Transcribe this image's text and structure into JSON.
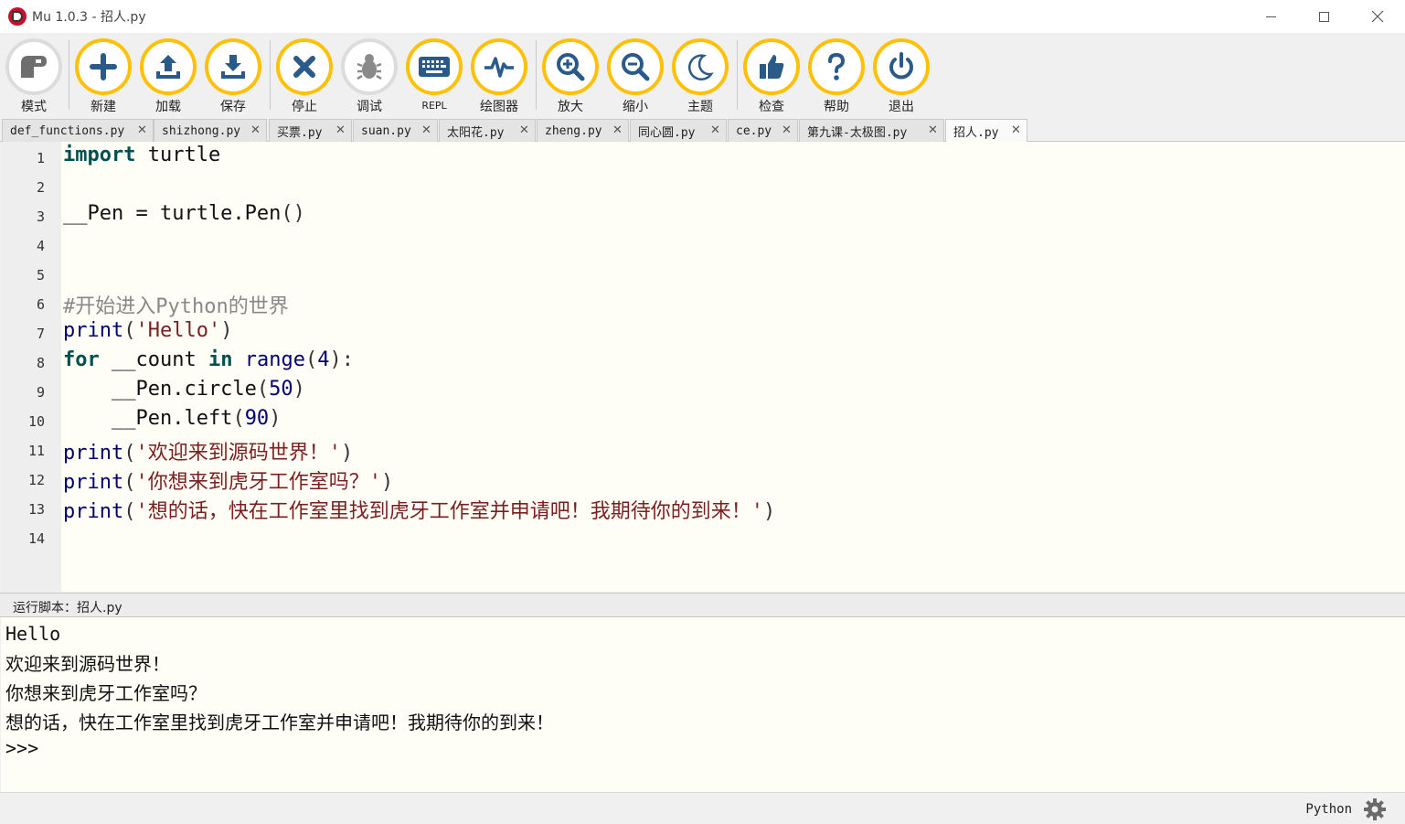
{
  "window": {
    "title": "Mu 1.0.3 - 招人.py"
  },
  "toolbar": {
    "buttons": [
      {
        "label": "模式",
        "icon": "mode-icon"
      },
      {
        "label": "新建",
        "icon": "plus-icon"
      },
      {
        "label": "加载",
        "icon": "load-icon"
      },
      {
        "label": "保存",
        "icon": "save-icon"
      },
      {
        "label": "停止",
        "icon": "stop-icon"
      },
      {
        "label": "调试",
        "icon": "bug-icon"
      },
      {
        "label": "REPL",
        "icon": "keyboard-icon"
      },
      {
        "label": "绘图器",
        "icon": "plotter-icon"
      },
      {
        "label": "放大",
        "icon": "zoom-in-icon"
      },
      {
        "label": "缩小",
        "icon": "zoom-out-icon"
      },
      {
        "label": "主题",
        "icon": "moon-icon"
      },
      {
        "label": "检查",
        "icon": "thumbs-up-icon"
      },
      {
        "label": "帮助",
        "icon": "help-icon"
      },
      {
        "label": "退出",
        "icon": "power-icon"
      }
    ]
  },
  "tabs": [
    {
      "label": "def_functions.py",
      "active": false
    },
    {
      "label": "shizhong.py",
      "active": false
    },
    {
      "label": "买票.py",
      "active": false
    },
    {
      "label": "suan.py",
      "active": false
    },
    {
      "label": "太阳花.py",
      "active": false
    },
    {
      "label": "zheng.py",
      "active": false
    },
    {
      "label": "同心圆.py",
      "active": false
    },
    {
      "label": "ce.py",
      "active": false
    },
    {
      "label": "第九课-太极图.py",
      "active": false
    },
    {
      "label": "招人.py",
      "active": true
    }
  ],
  "editor": {
    "line_numbers": [
      "1",
      "2",
      "3",
      "4",
      "5",
      "6",
      "7",
      "8",
      "9",
      "10",
      "11",
      "12",
      "13",
      "14"
    ],
    "code": {
      "l1_kw": "import",
      "l1_rest": " turtle",
      "l3_a": "__Pen = turtle.Pen",
      "l3_b": "()",
      "l6": "#开始进入Python的世界",
      "l7_fn": "print",
      "l7_p1": "(",
      "l7_str": "'Hello'",
      "l7_p2": ")",
      "l8_kw1": "for",
      "l8_a": " __count ",
      "l8_kw2": "in",
      "l8_sp": " ",
      "l8_fn": "range",
      "l8_p1": "(",
      "l8_num": "4",
      "l8_p2": "):",
      "l9_a": "    __Pen.circle",
      "l9_p1": "(",
      "l9_num": "50",
      "l9_p2": ")",
      "l10_a": "    __Pen.left",
      "l10_p1": "(",
      "l10_num": "90",
      "l10_p2": ")",
      "l11_fn": "print",
      "l11_p1": "(",
      "l11_str": "'欢迎来到源码世界！'",
      "l11_p2": ")",
      "l12_fn": "print",
      "l12_p1": "(",
      "l12_str": "'你想来到虎牙工作室吗？'",
      "l12_p2": ")",
      "l13_fn": "print",
      "l13_p1": "(",
      "l13_str": "'想的话，快在工作室里找到虎牙工作室并申请吧！我期待你的到来！'",
      "l13_p2": ")"
    }
  },
  "run_pane": {
    "title": "运行脚本：招人.py",
    "output": [
      "Hello",
      "欢迎来到源码世界！",
      "你想来到虎牙工作室吗？",
      "想的话，快在工作室里找到虎牙工作室并申请吧！我期待你的到来！",
      ">>>"
    ]
  },
  "status": {
    "mode": "Python",
    "settings_icon": "gear-icon"
  },
  "colors": {
    "accent": "#ffc107",
    "editor_bg": "#fefef7",
    "keyword": "#005050",
    "string": "#7a1f1f"
  }
}
